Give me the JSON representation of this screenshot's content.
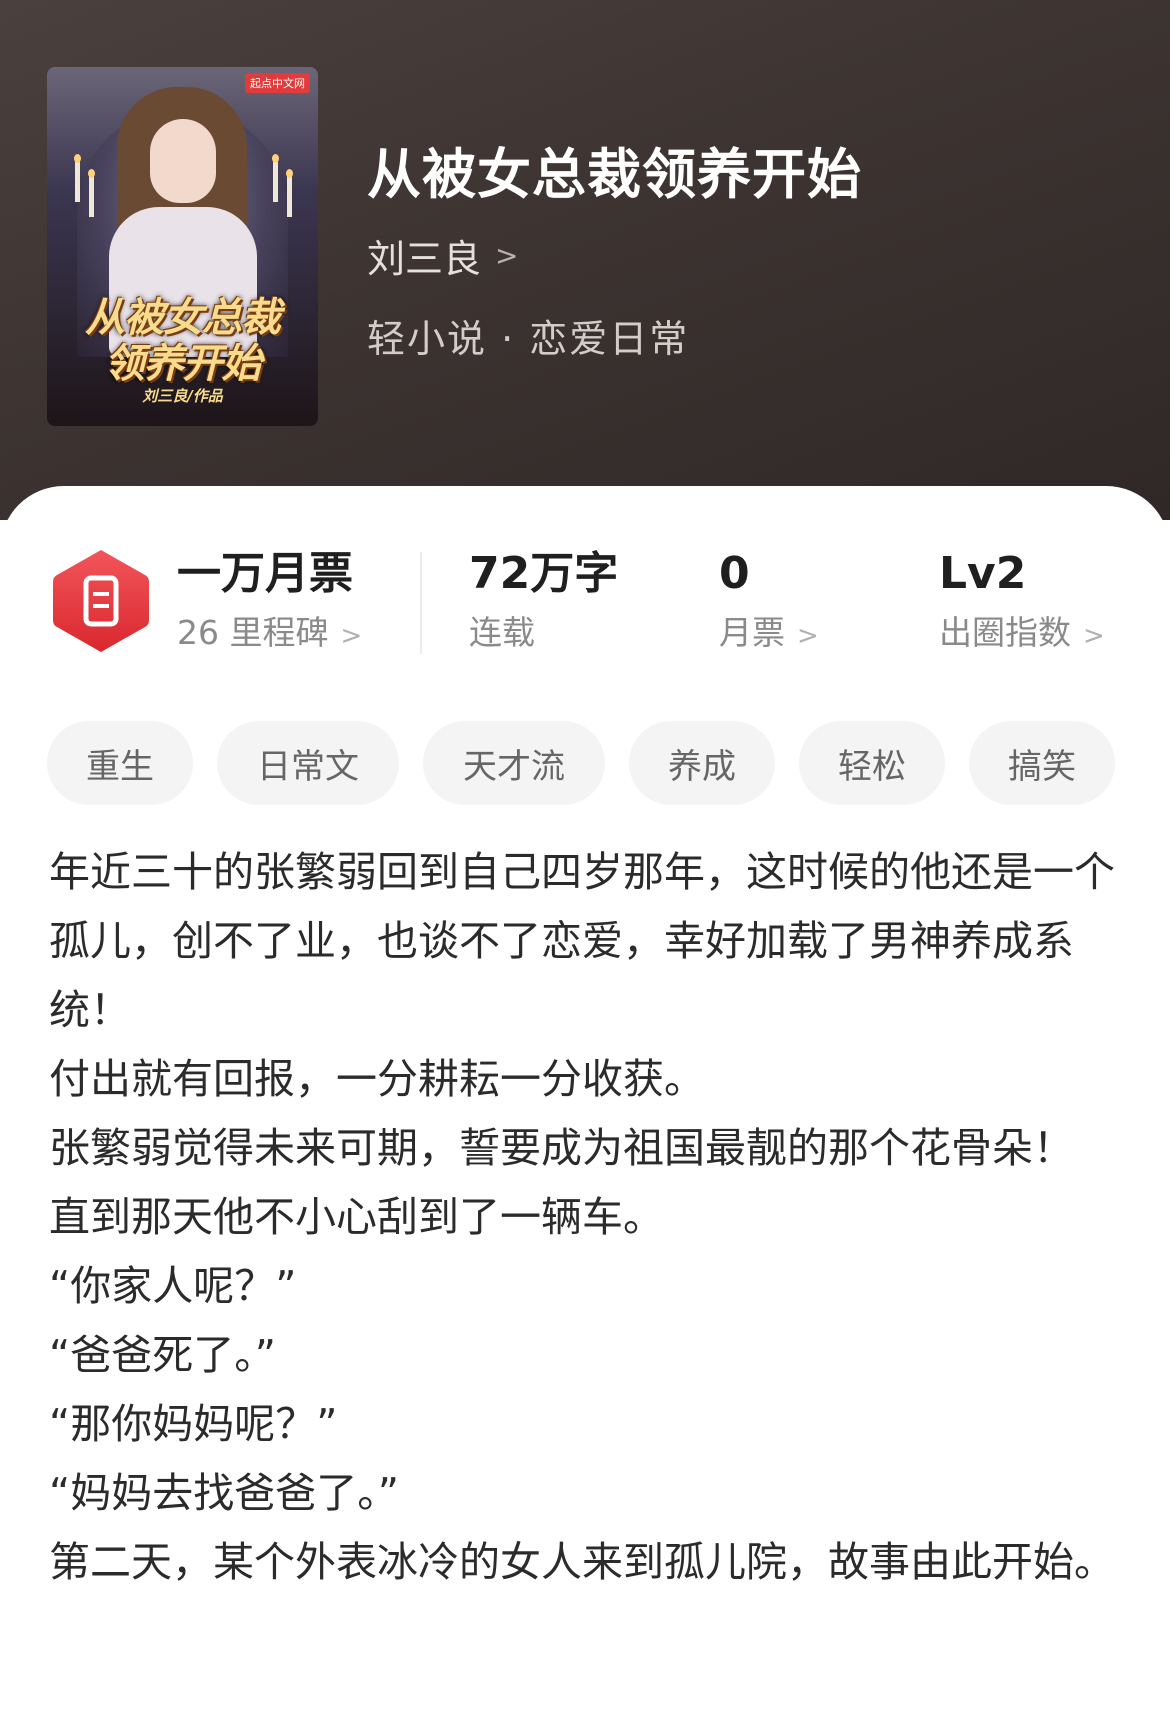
{
  "cover": {
    "badge": "起点中文网",
    "title_line1": "从被女总裁",
    "title_line2": "领养开始",
    "author_mark": "刘三良/作品"
  },
  "book": {
    "title": "从被女总裁领养开始",
    "author": "刘三良",
    "genre": "轻小说 · 恋爱日常"
  },
  "stats": {
    "ticket": {
      "main": "一万月票",
      "sub": "26 里程碑"
    },
    "words": {
      "main": "72万字",
      "sub": "连载"
    },
    "monthly": {
      "main": "0",
      "sub": "月票"
    },
    "index": {
      "main": "Lv2",
      "sub": "出圈指数"
    }
  },
  "tags": [
    "重生",
    "日常文",
    "天才流",
    "养成",
    "轻松",
    "搞笑"
  ],
  "synopsis": [
    "年近三十的张繁弱回到自己四岁那年，这时候的他还是一个孤儿，创不了业，也谈不了恋爱，幸好加载了男神养成系统！",
    "付出就有回报，一分耕耘一分收获。",
    "张繁弱觉得未来可期，誓要成为祖国最靓的那个花骨朵！",
    "直到那天他不小心刮到了一辆车。",
    "“你家人呢？”",
    "“爸爸死了。”",
    "“那你妈妈呢？”",
    "“妈妈去找爸爸了。”",
    "第二天，某个外表冰冷的女人来到孤儿院，故事由此开始。"
  ],
  "colors": {
    "header_bg": "#3d3432",
    "accent_red": "#e5383b",
    "tag_bg": "#f4f4f4"
  },
  "icons": {
    "ticket": "monthly-ticket-icon",
    "chevron": "chevron-right-icon"
  }
}
